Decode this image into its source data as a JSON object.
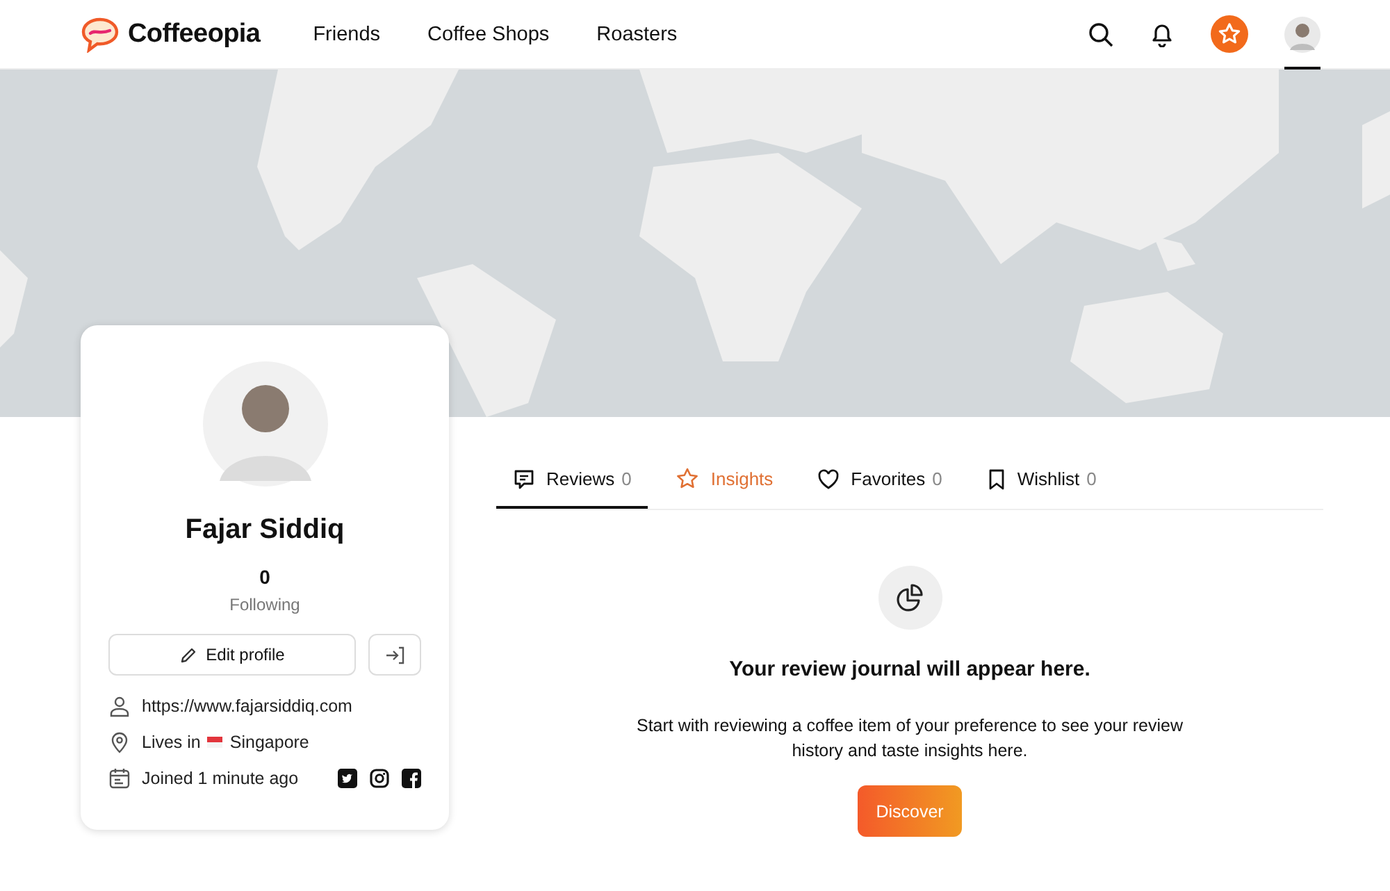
{
  "header": {
    "brand": "Coffeeopia",
    "nav": [
      {
        "label": "Friends"
      },
      {
        "label": "Coffee Shops"
      },
      {
        "label": "Roasters"
      }
    ]
  },
  "profile": {
    "name": "Fajar Siddiq",
    "stats": [
      {
        "value": "0",
        "label": "Following"
      }
    ],
    "edit_button": "Edit profile",
    "details": [
      {
        "kind": "website",
        "text": "https://www.fajarsiddiq.com"
      },
      {
        "kind": "location",
        "prefix": "Lives in",
        "text": "Singapore"
      },
      {
        "kind": "joined",
        "text": "Joined 1 minute ago"
      }
    ]
  },
  "tabs": [
    {
      "label": "Reviews",
      "count": "0",
      "kind": "reviews",
      "selected": true,
      "highlighted": false
    },
    {
      "label": "Insights",
      "kind": "insights",
      "selected": false,
      "highlighted": true
    },
    {
      "label": "Favorites",
      "count": "0",
      "kind": "favorites",
      "selected": false,
      "highlighted": false
    },
    {
      "label": "Wishlist",
      "count": "0",
      "kind": "wishlist",
      "selected": false,
      "highlighted": false
    }
  ],
  "empty_state": {
    "title": "Your review journal will appear here.",
    "message": "Start with reviewing a coffee item of your preference to see your review history and taste insights here.",
    "button": "Discover"
  }
}
